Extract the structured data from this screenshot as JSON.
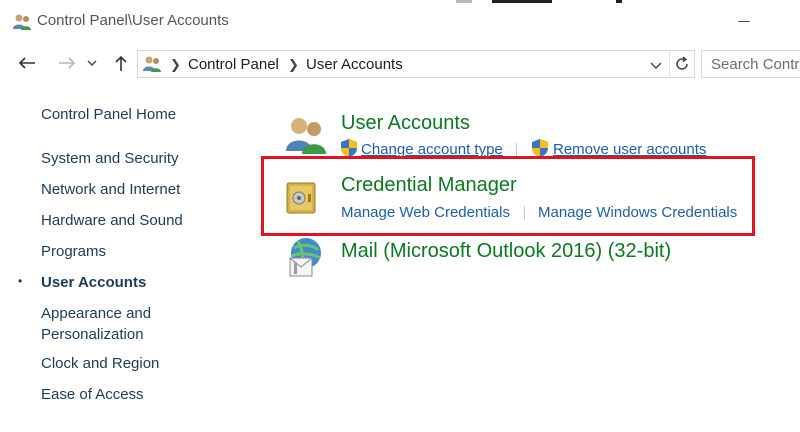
{
  "window": {
    "title": "Control Panel\\User Accounts",
    "icons": {
      "app": "user-accounts-icon",
      "minimize": "minimize-icon"
    }
  },
  "nav": {
    "back": "back-arrow-icon",
    "forward": "forward-arrow-icon",
    "recent": "chevron-down-icon",
    "up": "up-arrow-icon",
    "breadcrumb": [
      "Control Panel",
      "User Accounts"
    ],
    "search_placeholder": "Search Control Panel"
  },
  "sidebar": {
    "items": [
      {
        "label": "Control Panel Home",
        "active": false
      },
      {
        "label": "System and Security",
        "active": false
      },
      {
        "label": "Network and Internet",
        "active": false
      },
      {
        "label": "Hardware and Sound",
        "active": false
      },
      {
        "label": "Programs",
        "active": false
      },
      {
        "label": "User Accounts",
        "active": true
      },
      {
        "label": "Appearance and Personalization",
        "active": false
      },
      {
        "label": "Clock and Region",
        "active": false
      },
      {
        "label": "Ease of Access",
        "active": false
      }
    ],
    "appearance_line1": "Appearance and",
    "appearance_line2": "Personalization",
    "bullet": "•"
  },
  "main": {
    "user_accounts": {
      "heading": "User Accounts",
      "links": [
        "Change account type",
        "Remove user accounts"
      ]
    },
    "credential_manager": {
      "heading": "Credential Manager",
      "links": [
        "Manage Web Credentials",
        "Manage Windows Credentials"
      ]
    },
    "mail": {
      "heading": "Mail (Microsoft Outlook 2016) (32-bit)"
    }
  },
  "colors": {
    "heading_green": "#0a7a1e",
    "link_blue": "#1a5fb4",
    "highlight_red": "#e0141e"
  }
}
